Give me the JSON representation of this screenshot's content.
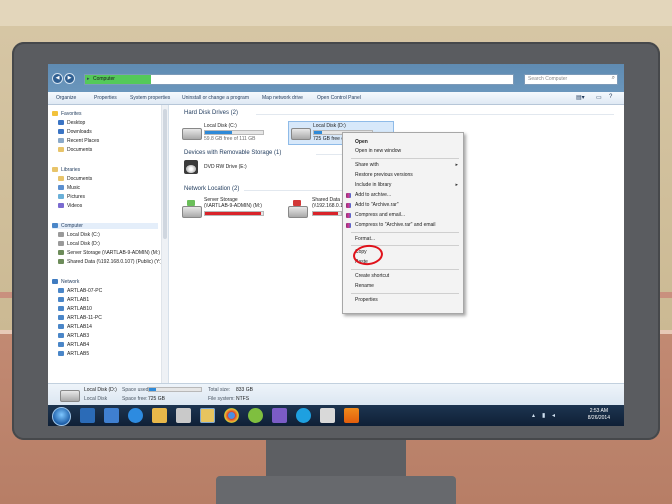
{
  "window": {
    "address": "Computer",
    "search_placeholder": "Search Computer"
  },
  "toolbar": {
    "organize": "Organize",
    "properties": "Properties",
    "system_properties": "System properties",
    "uninstall": "Uninstall or change a program",
    "map_drive": "Map network drive",
    "control_panel": "Open Control Panel"
  },
  "nav": {
    "favorites": "Favorites",
    "desktop": "Desktop",
    "downloads": "Downloads",
    "recent_places": "Recent Places",
    "documents": "Documents",
    "libraries": "Libraries",
    "lib_documents": "Documents",
    "music": "Music",
    "pictures": "Pictures",
    "videos": "Videos",
    "computer": "Computer",
    "local_c": "Local Disk (C:)",
    "local_d": "Local Disk (D:)",
    "server_storage": "Server Storage (\\\\ARTLAB-9-ADMIN) (M:)",
    "shared_data": "Shared Data (\\\\192.168.0.107) (Public) (Y:)",
    "network": "Network",
    "net_items": [
      "ARTLAB-07-PC",
      "ARTLAB1",
      "ARTLAB10",
      "ARTLAB-11-PC",
      "ARTLAB14",
      "ARTLAB3",
      "ARTLAB4",
      "ARTLAB5"
    ]
  },
  "content": {
    "hdd_header": "Hard Disk Drives (2)",
    "removable_header": "Devices with Removable Storage (1)",
    "network_header": "Network Location (2)",
    "local_c_name": "Local Disk (C:)",
    "local_c_free": "59.8 GB free of 111 GB",
    "local_c_used": 0.46,
    "local_d_name": "Local Disk (D:)",
    "local_d_free": "725 GB free o",
    "local_d_used": 0.13,
    "dvd_name": "DVD RW Drive (E:)",
    "server_name": "Server Storage",
    "server_path": "(\\\\ARTLAB-9-ADMIN) (M:)",
    "server_used": 0.96,
    "shared_name": "Shared Data",
    "shared_path": "(\\\\192.168.0.10",
    "shared_used": 0.9
  },
  "context_menu": {
    "open": "Open",
    "open_new_window": "Open in new window",
    "share_with": "Share with",
    "restore_versions": "Restore previous versions",
    "include_library": "Include in library",
    "add_archive": "Add to archive...",
    "add_archive_rar": "Add to \"Archive.rar\"",
    "compress_email": "Compress and email...",
    "compress_rar_email": "Compress to \"Archive.rar\" and email",
    "format": "Format...",
    "copy": "Copy",
    "paste": "Paste",
    "create_shortcut": "Create shortcut",
    "rename": "Rename",
    "properties": "Properties"
  },
  "details": {
    "name": "Local Disk (D:)",
    "space_used_label": "Space used:",
    "space_used": 0.13,
    "type": "Local Disk",
    "space_free_label": "Space free:",
    "space_free": "725 GB",
    "total_size_label": "Total size:",
    "total_size": "833 GB",
    "filesystem_label": "File system:",
    "filesystem": "NTFS"
  },
  "taskbar": {
    "time": "2:53 AM",
    "date": "8/26/2014"
  },
  "colors": {
    "accent": "#2f8ad8",
    "highlight_circle": "#e0121b",
    "taskbar": "#14283f"
  }
}
